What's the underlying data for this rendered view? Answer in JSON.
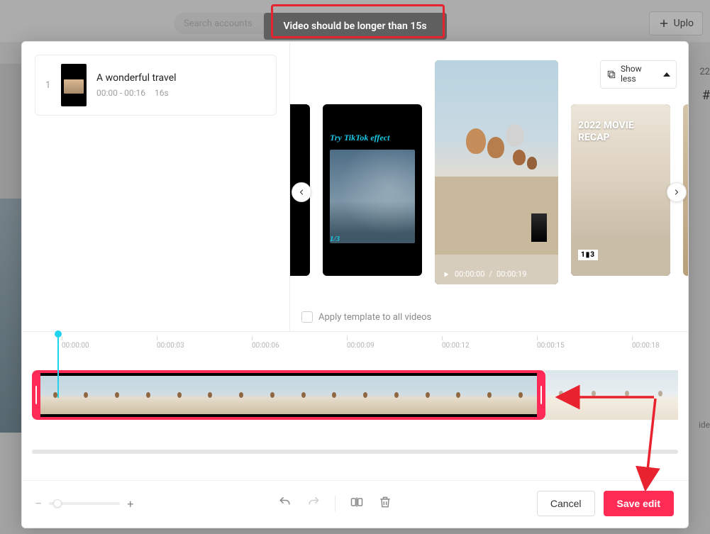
{
  "background": {
    "search_placeholder": "Search accounts",
    "upload_label": "Uplo",
    "right_year": "22",
    "right_hash": "#",
    "side_text": "ide"
  },
  "toast": {
    "message": "Video should be longer than 15s"
  },
  "clips": [
    {
      "index": "1",
      "title": "A wonderful travel",
      "time_range": "00:00 - 00:16",
      "duration": "16s"
    }
  ],
  "show_toggle": {
    "label": "Show less"
  },
  "templates": {
    "effect_label": "Try TikTok effect",
    "effect_page": "1/3",
    "selected": {
      "current_time": "00:00:00",
      "total_time": "00:00:19"
    },
    "movie": {
      "title": "2022 MOVIE RECAP",
      "page_badge": "1▮3"
    }
  },
  "apply_all": {
    "label": "Apply template to all videos"
  },
  "ruler": {
    "t0": "00:00:00",
    "t1": "00:00:03",
    "t2": "00:00:06",
    "t3": "00:00:09",
    "t4": "00:00:12",
    "t5": "00:00:15",
    "t6": "00:00:18"
  },
  "zoom": {
    "minus": "−",
    "plus": "+"
  },
  "actions": {
    "cancel": "Cancel",
    "save": "Save edit"
  }
}
